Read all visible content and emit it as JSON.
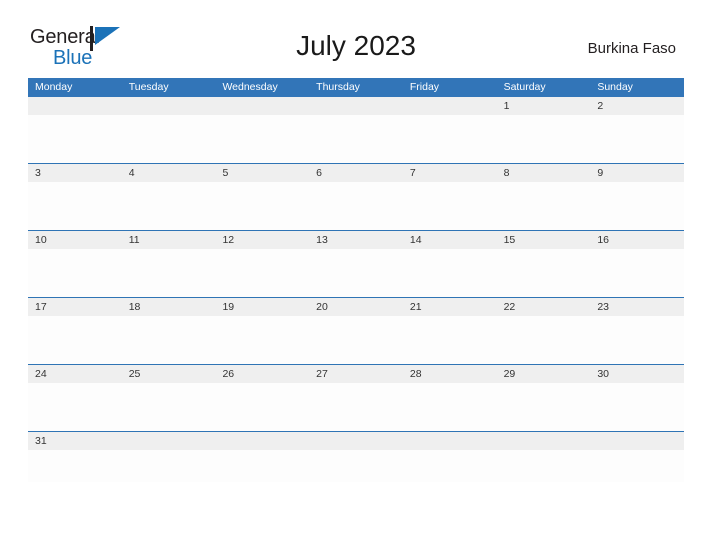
{
  "brand": {
    "name_part1": "General",
    "name_part2": "Blue",
    "flag_icon": "flag-triangle-icon",
    "colors": {
      "text_dark": "#231f20",
      "blue": "#1b72b8"
    }
  },
  "header": {
    "title": "July 2023",
    "country": "Burkina Faso"
  },
  "calendar": {
    "colors": {
      "header_blue": "#3275b8",
      "row_divider_blue": "#2f74b5",
      "cell_band_gray": "#efefef",
      "cell_body": "#fdfdfd",
      "day_number_text": "#333333",
      "dow_text": "#ffffff"
    },
    "weekday_headers": [
      "Monday",
      "Tuesday",
      "Wednesday",
      "Thursday",
      "Friday",
      "Saturday",
      "Sunday"
    ],
    "weeks": [
      [
        "",
        "",
        "",
        "",
        "",
        "1",
        "2"
      ],
      [
        "3",
        "4",
        "5",
        "6",
        "7",
        "8",
        "9"
      ],
      [
        "10",
        "11",
        "12",
        "13",
        "14",
        "15",
        "16"
      ],
      [
        "17",
        "18",
        "19",
        "20",
        "21",
        "22",
        "23"
      ],
      [
        "24",
        "25",
        "26",
        "27",
        "28",
        "29",
        "30"
      ],
      [
        "31",
        "",
        "",
        "",
        "",
        "",
        ""
      ]
    ]
  }
}
